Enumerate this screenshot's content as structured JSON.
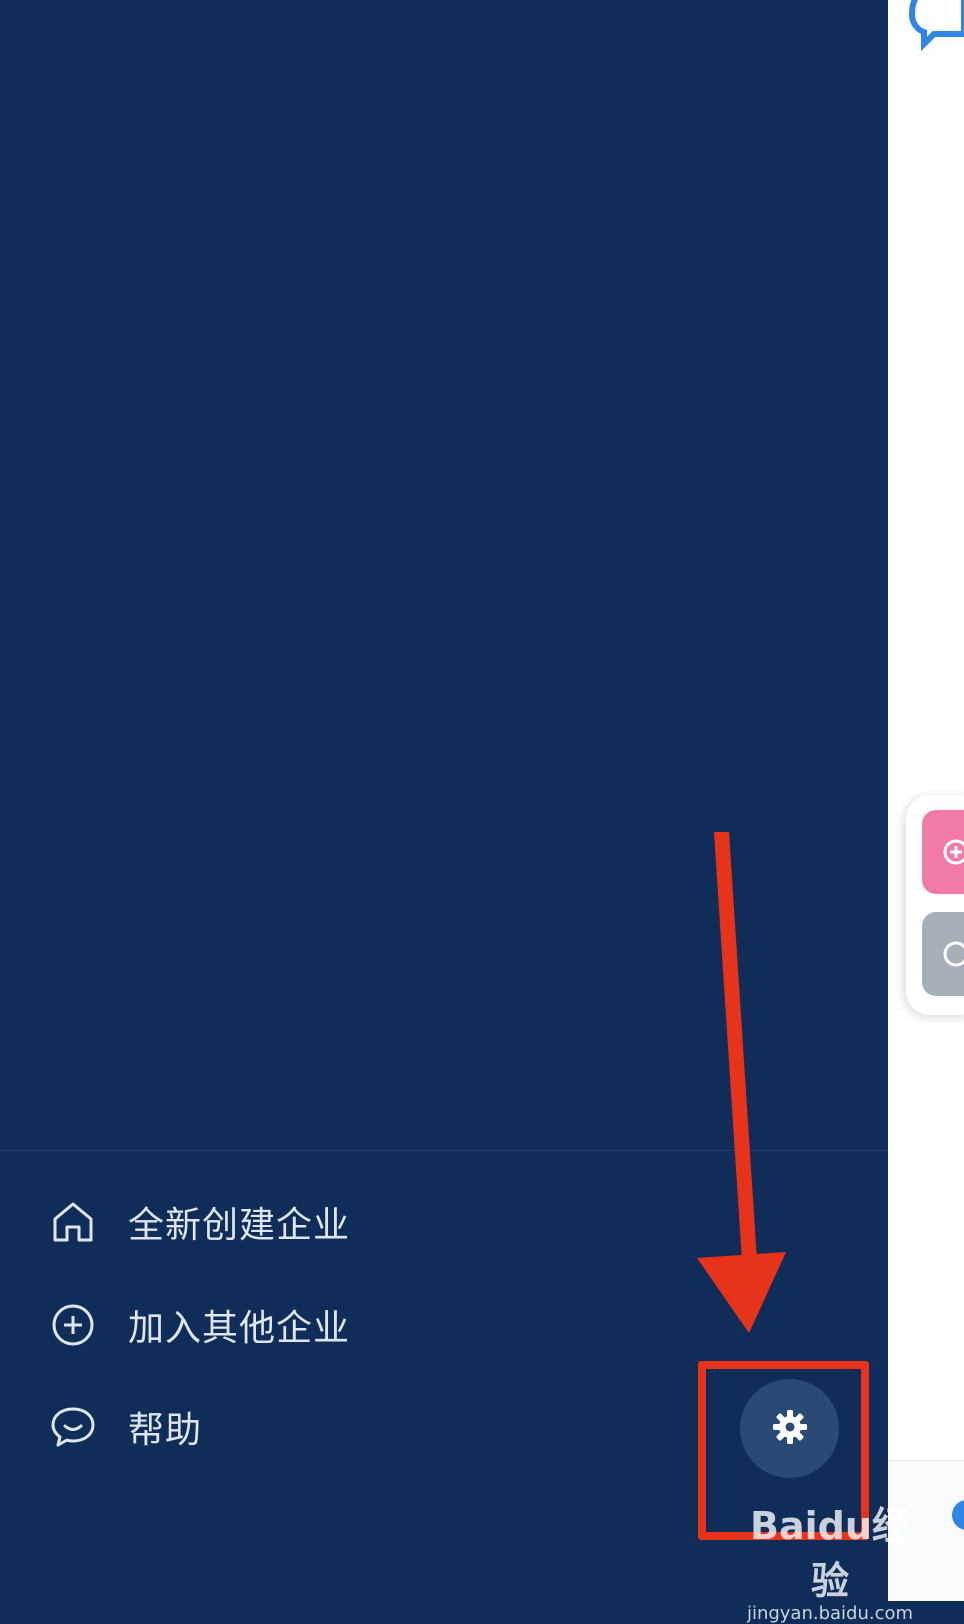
{
  "colors": {
    "drawer_background": "#102d5a",
    "menu_text": "#dfe6f1",
    "settings_button_bg": "#294a74",
    "annotation_red": "#e8331b",
    "peek_pink": "#f27aa6",
    "peek_gray": "#a7b0b9",
    "peek_blue": "#2f86e6"
  },
  "menu": {
    "items": [
      {
        "label": "全新创建企业",
        "icon": "home-icon"
      },
      {
        "label": "加入其他企业",
        "icon": "plus-circle-icon"
      },
      {
        "label": "帮助",
        "icon": "chat-bubble-icon"
      }
    ]
  },
  "settings": {
    "icon": "gear-icon"
  },
  "annotation": {
    "arrow": "red-arrow-down",
    "box": "red-highlight-box"
  },
  "watermark": {
    "brand": "Baidu经验",
    "url": "jingyan.baidu.com"
  }
}
